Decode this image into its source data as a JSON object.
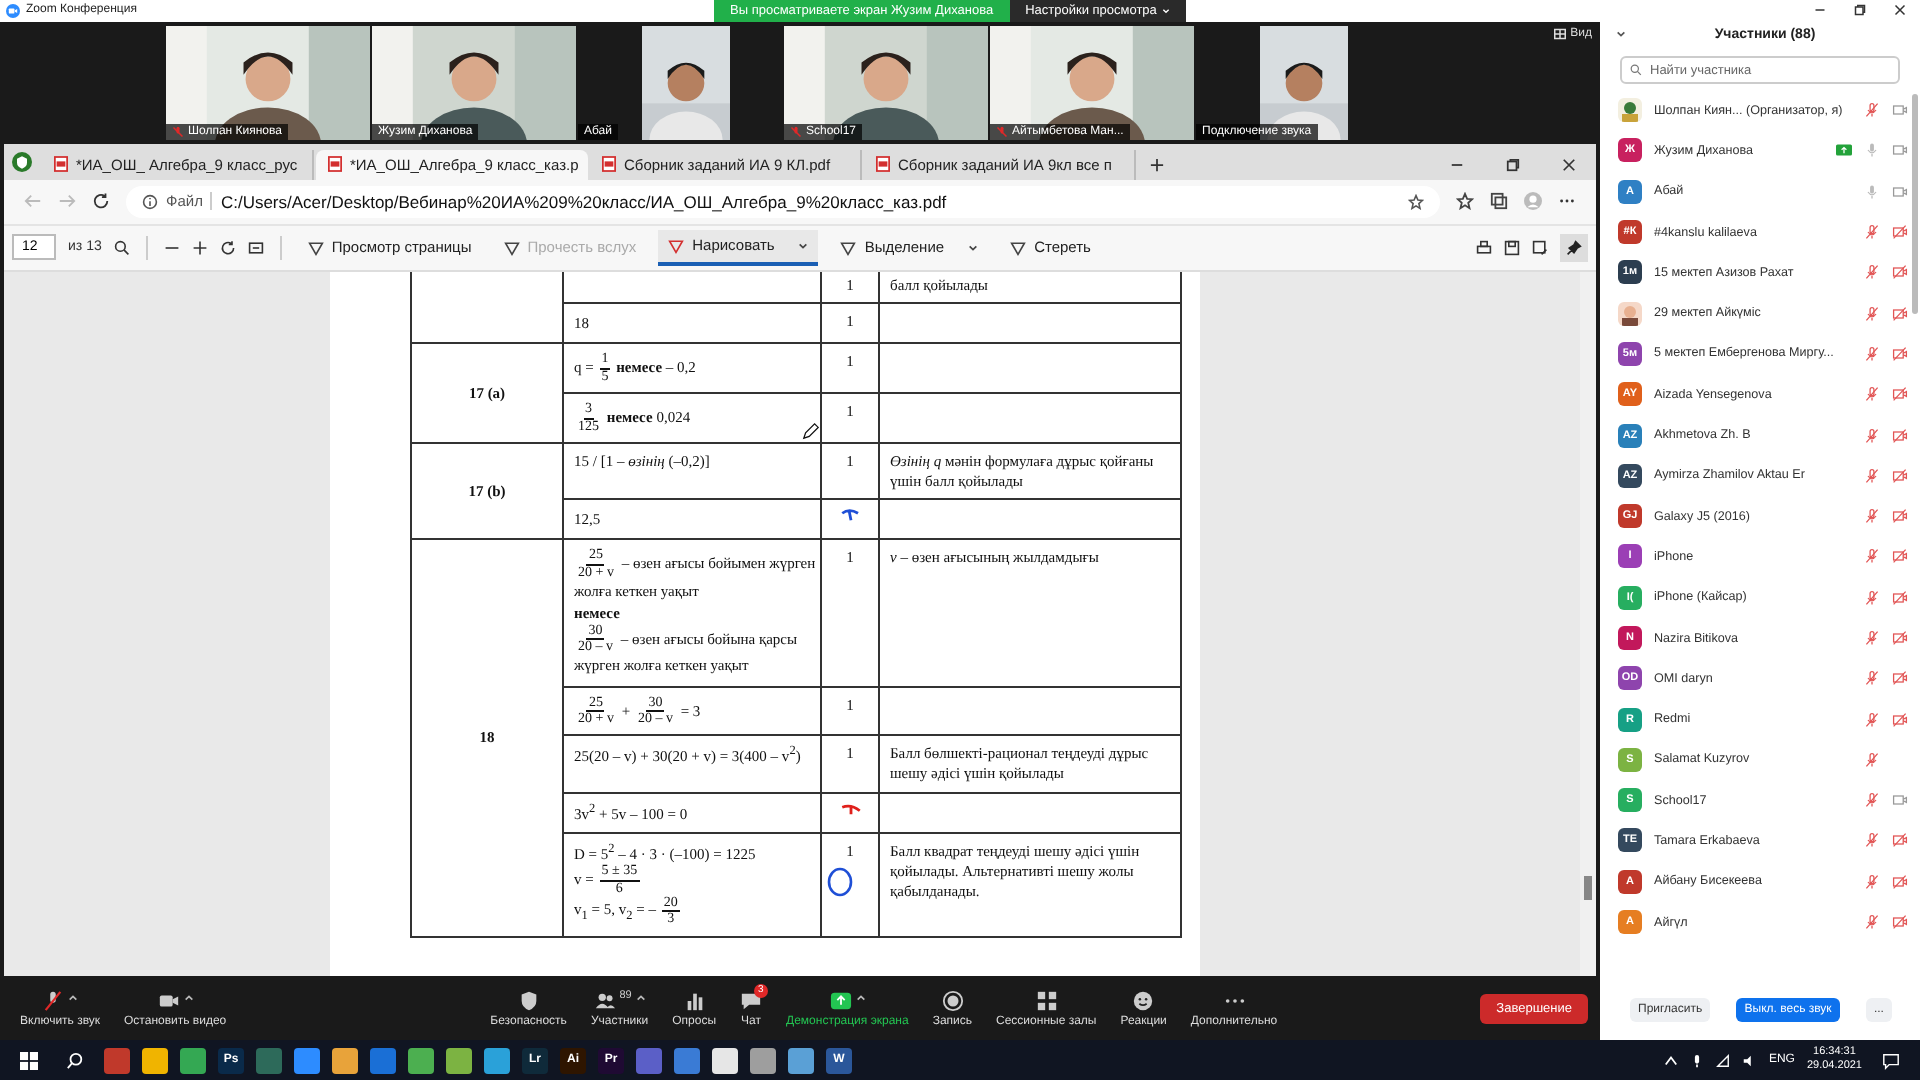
{
  "window": {
    "title": "Zoom Конференция"
  },
  "share_banner": {
    "text": "Вы просматриваете экран Жузим Диханова",
    "settings": "Настройки просмотра"
  },
  "view_button": "Вид",
  "videos": [
    {
      "name": "Шолпан Киянова",
      "muted": true,
      "kind": "landscape"
    },
    {
      "name": "Жузим Диханова",
      "muted": false,
      "kind": "landscape"
    },
    {
      "name": "Абай",
      "muted": false,
      "kind": "portrait"
    },
    {
      "name": "School17",
      "muted": true,
      "kind": "landscape"
    },
    {
      "name": "Айтымбетова Ман...",
      "muted": true,
      "kind": "landscape"
    },
    {
      "name": "Подключение звука",
      "muted": false,
      "kind": "portrait"
    }
  ],
  "browser": {
    "tabs": [
      {
        "label": "*ИА_ОШ_ Алгебра_9 класс_рус",
        "selected": false
      },
      {
        "label": "*ИА_ОШ_Алгебра_9 класс_каз.р",
        "selected": true
      },
      {
        "label": "Сборник заданий ИА 9 КЛ.pdf",
        "selected": false
      },
      {
        "label": "Сборник заданий ИА 9кл все п",
        "selected": false
      }
    ],
    "address": {
      "scheme": "Файл",
      "url": "C:/Users/Acer/Desktop/Вебинар%20ИА%209%20класс/ИА_ОШ_Алгебра_9%20класс_каз.pdf"
    },
    "pdf_toolbar": {
      "page": "12",
      "of": "из 13",
      "items": [
        {
          "label": "Просмотр страницы",
          "disabled": false,
          "selected": false,
          "caret": false
        },
        {
          "label": "Прочесть вслух",
          "disabled": true,
          "selected": false,
          "caret": false
        },
        {
          "label": "Нарисовать",
          "disabled": false,
          "selected": true,
          "caret": true
        },
        {
          "label": "Выделение",
          "disabled": false,
          "selected": false,
          "caret": true
        },
        {
          "label": "Стереть",
          "disabled": false,
          "selected": false,
          "caret": false
        }
      ]
    }
  },
  "document": {
    "questions": [
      {
        "parts": [
          {
            "score": "1",
            "note": "балл қойылады"
          },
          {
            "lines": [
              [
                {
                  "kind": "text",
                  "text": "18"
                }
              ]
            ],
            "score": "1"
          }
        ]
      },
      {
        "label": "17 (a)",
        "parts": [
          {
            "lines": [
              [
                {
                  "kind": "text",
                  "text": "q = "
                },
                {
                  "kind": "frac",
                  "num": "1",
                  "den": "5"
                },
                {
                  "kind": "text",
                  "text": " **немесе** – 0,2"
                }
              ]
            ],
            "score": "1"
          },
          {
            "lines": [
              [
                {
                  "kind": "frac",
                  "num": "3",
                  "den": "125"
                },
                {
                  "kind": "text",
                  "text": " **немесе** 0,024"
                }
              ]
            ],
            "score": "1"
          }
        ]
      },
      {
        "label": "17 (b)",
        "parts": [
          {
            "lines": [
              [
                {
                  "kind": "text",
                  "text": "15 / [1 – *өзінің* (–0,2)]"
                }
              ]
            ],
            "score": "1",
            "note": "*Өзінің q* мәнін формулаға дұрыс қойғаны үшін балл қойылады"
          },
          {
            "lines": [
              [
                {
                  "kind": "text",
                  "text": "12,5"
                }
              ]
            ],
            "pen": {
              "kind": "hook",
              "color": "#1f4fd6"
            }
          }
        ]
      },
      {
        "label": "18",
        "parts": [
          {
            "lines": [
              [
                {
                  "kind": "frac",
                  "num": "25",
                  "den": "20 + v"
                },
                {
                  "kind": "text",
                  "text": " – өзен ағысы бойымен жүрген"
                }
              ],
              [
                {
                  "kind": "text",
                  "text": "жолға кеткен уақыт"
                }
              ],
              [
                {
                  "kind": "text",
                  "text": "**немесе**"
                }
              ],
              [
                {
                  "kind": "frac",
                  "num": "30",
                  "den": "20 – v"
                },
                {
                  "kind": "text",
                  "text": " – өзен ағысы бойына қарсы"
                }
              ],
              [
                {
                  "kind": "text",
                  "text": "жүрген жолға кеткен уақыт"
                }
              ]
            ],
            "score": "1",
            "note": "*v* – өзен ағысының жылдамдығы"
          },
          {
            "lines": [
              [
                {
                  "kind": "frac",
                  "num": "25",
                  "den": "20 + v"
                },
                {
                  "kind": "text",
                  "text": " + "
                },
                {
                  "kind": "frac",
                  "num": "30",
                  "den": "20 – v"
                },
                {
                  "kind": "text",
                  "text": " = 3"
                }
              ]
            ],
            "score": "1"
          },
          {
            "lines": [
              [
                {
                  "kind": "text",
                  "text": "25(20 – v) + 30(20 + v) = 3(400 – v$^{2}$)"
                }
              ]
            ],
            "score": "1",
            "note": "Балл бөлшекті-рационал теңдеуді дұрыс шешу әдісі үшін қойылады"
          },
          {
            "lines": [
              [
                {
                  "kind": "text",
                  "text": "3v$^{2}$ + 5v – 100 = 0"
                }
              ]
            ],
            "pen": {
              "kind": "strike",
              "color": "#e0201b"
            }
          },
          {
            "lines": [
              [
                {
                  "kind": "text",
                  "text": "D = 5$^{2}$ – 4 · 3 · (–100) = 1225"
                }
              ],
              [
                {
                  "kind": "text",
                  "text": "v = "
                },
                {
                  "kind": "frac",
                  "num": "5 ± 35",
                  "den": "6"
                }
              ],
              [
                {
                  "kind": "text",
                  "text": "v$_{1}$ = 5, v$_{2}$ = – "
                },
                {
                  "kind": "frac",
                  "num": "20",
                  "den": "3"
                }
              ]
            ],
            "score": "1",
            "note": "Балл квадрат теңдеуді шешу әдісі үшін қойылады. Альтернативті шешу жолы қабылданады.",
            "pen": {
              "kind": "circle",
              "color": "#1f4fd6"
            }
          }
        ]
      }
    ]
  },
  "toolbar": {
    "items": [
      {
        "label": "Включить звук",
        "caret": true
      },
      {
        "label": "Остановить видео",
        "caret": true
      },
      {
        "label": "Безопасность",
        "caret": false
      },
      {
        "label": "Участники",
        "caret": true,
        "count": "89"
      },
      {
        "label": "Опросы",
        "caret": false
      },
      {
        "label": "Чат",
        "caret": false,
        "badge": "3"
      },
      {
        "label": "Демонстрация экрана",
        "caret": true
      },
      {
        "label": "Запись",
        "caret": false
      },
      {
        "label": "Сессионные залы",
        "caret": false
      },
      {
        "label": "Реакции",
        "caret": false
      },
      {
        "label": "Дополнительно",
        "caret": false
      }
    ],
    "end_button": "Завершение"
  },
  "participants": {
    "title": "Участники (88)",
    "search": {
      "placeholder": "Найти участника"
    },
    "items": [
      {
        "name": "Шолпан Киян... (Организатор, я)",
        "muted": true,
        "video": true,
        "sharing": false
      },
      {
        "name": "Жузим Диханова",
        "avatar": {
          "kind": "initials",
          "text": "Ж",
          "color": "#c8215f"
        },
        "muted": false,
        "video": true,
        "sharing": true
      },
      {
        "name": "Абай",
        "avatar": {
          "kind": "initials",
          "text": "A",
          "color": "#2f80c4"
        },
        "muted": false,
        "video": true,
        "sharing": false
      },
      {
        "name": "#4kanslu kalilaeva",
        "avatar": {
          "kind": "initials",
          "text": "#К",
          "color": "#c0392b"
        },
        "muted": true,
        "video": false,
        "sharing": false
      },
      {
        "name": "15 мектеп Азизов Рахат",
        "avatar": {
          "kind": "initials",
          "text": "1м",
          "color": "#2c3e50"
        },
        "muted": true,
        "video": false,
        "sharing": false
      },
      {
        "name": "29 мектеп Айкүміс",
        "muted": true,
        "video": false,
        "sharing": false
      },
      {
        "name": "5 мектеп Ембергенова Миргу...",
        "avatar": {
          "kind": "initials",
          "text": "5м",
          "color": "#8e44ad"
        },
        "muted": true,
        "video": false,
        "sharing": false
      },
      {
        "name": "Aizada Yensegenova",
        "avatar": {
          "kind": "initials",
          "text": "AY",
          "color": "#e0601b"
        },
        "muted": true,
        "video": false,
        "sharing": false
      },
      {
        "name": "Akhmetova Zh. B",
        "avatar": {
          "kind": "initials",
          "text": "AZ",
          "color": "#2980b9"
        },
        "muted": true,
        "video": false,
        "sharing": false
      },
      {
        "name": "Aymirza Zhamilov Aktau Er",
        "avatar": {
          "kind": "initials",
          "text": "AZ",
          "color": "#34495e"
        },
        "muted": true,
        "video": false,
        "sharing": false
      },
      {
        "name": "Galaxy J5 (2016)",
        "avatar": {
          "kind": "initials",
          "text": "GJ",
          "color": "#c0392b"
        },
        "muted": true,
        "video": false,
        "sharing": false
      },
      {
        "name": "iPhone",
        "avatar": {
          "kind": "initials",
          "text": "I",
          "color": "#9b3fb5"
        },
        "muted": true,
        "video": false,
        "sharing": false
      },
      {
        "name": "iPhone (Кайсар)",
        "avatar": {
          "kind": "initials",
          "text": "I(",
          "color": "#27ae60"
        },
        "muted": true,
        "video": false,
        "sharing": false
      },
      {
        "name": "Nazira Bitikova",
        "avatar": {
          "kind": "initials",
          "text": "N",
          "color": "#c2185b"
        },
        "muted": true,
        "video": false,
        "sharing": false
      },
      {
        "name": "OMI daryn",
        "avatar": {
          "kind": "initials",
          "text": "OD",
          "color": "#8e44ad"
        },
        "muted": true,
        "video": false,
        "sharing": false
      },
      {
        "name": "Redmi",
        "avatar": {
          "kind": "initials",
          "text": "R",
          "color": "#16a085"
        },
        "muted": true,
        "video": false,
        "sharing": false
      },
      {
        "name": "Salamat Kuzyrov",
        "avatar": {
          "kind": "initials",
          "text": "S",
          "color": "#7cb342"
        },
        "muted": true,
        "sharing": false
      },
      {
        "name": "School17",
        "avatar": {
          "kind": "initials",
          "text": "S",
          "color": "#27ae60"
        },
        "muted": true,
        "video": true,
        "sharing": false
      },
      {
        "name": "Tamara Erkabaeva",
        "avatar": {
          "kind": "initials",
          "text": "TE",
          "color": "#34495e"
        },
        "muted": true,
        "video": false,
        "sharing": false
      },
      {
        "name": "Айбану Бисекеева",
        "avatar": {
          "kind": "initials",
          "text": "A",
          "color": "#c0392b"
        },
        "muted": true,
        "video": false,
        "sharing": false
      },
      {
        "name": "Айгүл",
        "avatar": {
          "kind": "initials",
          "text": "A",
          "color": "#e67e22"
        },
        "muted": true,
        "video": false,
        "sharing": false
      }
    ],
    "buttons": [
      {
        "label": "Пригласить",
        "kind": "secondary"
      },
      {
        "label": "Выкл. весь звук",
        "kind": "primary"
      },
      {
        "label": "...",
        "kind": "secondary"
      }
    ]
  },
  "taskbar": {
    "apps": [
      {
        "color": "#c0392b"
      },
      {
        "color": "#f0b400"
      },
      {
        "color": "#34a853"
      },
      {
        "label": "Ps",
        "color": "#0a2a4a"
      },
      {
        "color": "#2d6a5a"
      },
      {
        "color": "#2d8cff"
      },
      {
        "color": "#e8a33a"
      },
      {
        "color": "#1a6fd6"
      },
      {
        "color": "#4caf50"
      },
      {
        "color": "#7cb342"
      },
      {
        "color": "#2aa1d9"
      },
      {
        "label": "Lr",
        "color": "#0f2a3a"
      },
      {
        "label": "Ai",
        "color": "#2e1500"
      },
      {
        "label": "Pr",
        "color": "#1f0a33"
      },
      {
        "color": "#5b5fc7"
      },
      {
        "color": "#3a7bd5"
      },
      {
        "color": "#e6e6e6"
      },
      {
        "color": "#9e9e9e"
      },
      {
        "color": "#5aa0d6"
      },
      {
        "label": "W",
        "color": "#2b579a"
      }
    ],
    "lang": "ENG",
    "time": "16:34:31",
    "date": "29.04.2021"
  }
}
